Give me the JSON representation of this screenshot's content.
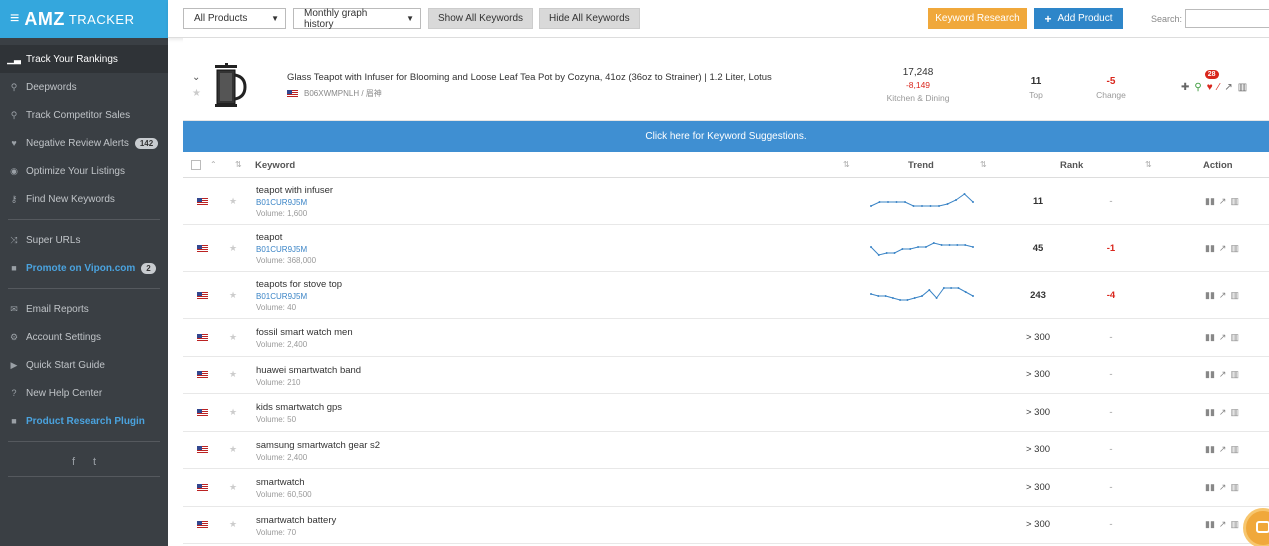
{
  "sidebar": {
    "logo_amz": "AMZ",
    "logo_tracker": "TRACKER",
    "items": [
      {
        "label": "Track Your Rankings",
        "icon": "bars-icon"
      },
      {
        "label": "Deepwords",
        "icon": "search-icon"
      },
      {
        "label": "Track Competitor Sales",
        "icon": "search-icon"
      },
      {
        "label": "Negative Review Alerts",
        "icon": "heart-icon",
        "badge": "142"
      },
      {
        "label": "Optimize Your Listings",
        "icon": "eye-icon"
      },
      {
        "label": "Find New Keywords",
        "icon": "key-icon"
      },
      {
        "label": "Super URLs",
        "icon": "shuffle-icon"
      },
      {
        "label": "Promote on Vipon.com",
        "icon": "gift-icon",
        "badge": "2"
      },
      {
        "label": "Email Reports",
        "icon": "envelope-icon"
      },
      {
        "label": "Account Settings",
        "icon": "gear-icon"
      },
      {
        "label": "Quick Start Guide",
        "icon": "video-icon"
      },
      {
        "label": "New Help Center",
        "icon": "question-icon"
      },
      {
        "label": "Product Research Plugin",
        "icon": "gift-icon"
      }
    ],
    "social": [
      "f",
      "t"
    ]
  },
  "toolbar": {
    "products_select": "All Products",
    "history_select": "Monthly graph history",
    "show_keywords": "Show All Keywords",
    "hide_keywords": "Hide All Keywords",
    "keyword_research": "Keyword Research",
    "add_product": "Add Product",
    "search_label": "Search:",
    "search_value": ""
  },
  "product": {
    "title": "Glass Teapot with Infuser for Blooming and Loose Leaf Tea Pot by Cozyna, 41oz (36oz to Strainer) | 1.2 Liter, Lotus",
    "asin": "B06XWMPNLH / 眉神",
    "bsr_value": "17,248",
    "bsr_delta": "-8,149",
    "bsr_category": "Kitchen & Dining",
    "top_value": "11",
    "top_label": "Top",
    "change_value": "-5",
    "change_label": "Change",
    "alert_count": "28"
  },
  "banner": "Click here for Keyword Suggestions.",
  "table": {
    "headers": {
      "keyword": "Keyword",
      "trend": "Trend",
      "rank": "Rank",
      "action": "Action"
    },
    "rows": [
      {
        "keyword": "teapot with infuser",
        "asin": "B01CUR9J5M",
        "volume": "Volume: 1,600",
        "rank": "11",
        "delta": "-",
        "trend": [
          3,
          5,
          5,
          5,
          5,
          3,
          3,
          3,
          3,
          4,
          6,
          9,
          5
        ]
      },
      {
        "keyword": "teapot",
        "asin": "B01CUR9J5M",
        "volume": "Volume: 368,000",
        "rank": "45",
        "delta": "-1",
        "trend": [
          6,
          2,
          3,
          3,
          5,
          5,
          6,
          6,
          8,
          7,
          7,
          7,
          7,
          6
        ]
      },
      {
        "keyword": "teapots for stove top",
        "asin": "B01CUR9J5M",
        "volume": "Volume: 40",
        "rank": "243",
        "delta": "-4",
        "trend": [
          6,
          5,
          5,
          4,
          3,
          3,
          4,
          5,
          8,
          4,
          9,
          9,
          9,
          7,
          5
        ]
      },
      {
        "keyword": "fossil smart watch men",
        "asin": "",
        "volume": "Volume: 2,400",
        "rank": "> 300",
        "delta": "-"
      },
      {
        "keyword": "huawei smartwatch band",
        "asin": "",
        "volume": "Volume: 210",
        "rank": "> 300",
        "delta": "-"
      },
      {
        "keyword": "kids smartwatch gps",
        "asin": "",
        "volume": "Volume: 50",
        "rank": "> 300",
        "delta": "-"
      },
      {
        "keyword": "samsung smartwatch gear s2",
        "asin": "",
        "volume": "Volume: 2,400",
        "rank": "> 300",
        "delta": "-"
      },
      {
        "keyword": "smartwatch",
        "asin": "",
        "volume": "Volume: 60,500",
        "rank": "> 300",
        "delta": "-"
      },
      {
        "keyword": "smartwatch battery",
        "asin": "",
        "volume": "Volume: 70",
        "rank": "> 300",
        "delta": "-"
      }
    ]
  },
  "colors": {
    "accent": "#34a7dd",
    "banner": "#3f8fd2",
    "orange": "#f0a83b",
    "negative": "#d9261c"
  }
}
